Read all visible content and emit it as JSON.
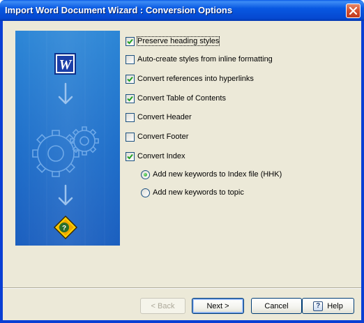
{
  "window": {
    "title": "Import Word Document Wizard : Conversion Options"
  },
  "side_panel": {
    "word_icon_letter": "W",
    "help_icon_glyph": "?",
    "colors": {
      "panel": "#1f6fca",
      "accent": "#ffd200"
    }
  },
  "options": [
    {
      "id": "preserve-heading-styles",
      "label": "Preserve heading styles",
      "checked": true
    },
    {
      "id": "auto-create-styles",
      "label": "Auto-create styles from inline formatting",
      "checked": false
    },
    {
      "id": "convert-references",
      "label": "Convert references into hyperlinks",
      "checked": true
    },
    {
      "id": "convert-toc",
      "label": "Convert Table of Contents",
      "checked": true
    },
    {
      "id": "convert-header",
      "label": "Convert Header",
      "checked": false
    },
    {
      "id": "convert-footer",
      "label": "Convert Footer",
      "checked": false
    },
    {
      "id": "convert-index",
      "label": "Convert Index",
      "checked": true
    }
  ],
  "index_keyword_options": [
    {
      "id": "add-to-index-file",
      "label": "Add new keywords to Index file (HHK)",
      "selected": true
    },
    {
      "id": "add-to-topic",
      "label": "Add new keywords to topic",
      "selected": false
    }
  ],
  "buttons": {
    "back_label": "< Back",
    "next_label": "Next >",
    "cancel_label": "Cancel",
    "help_label": "Help",
    "help_glyph": "?"
  }
}
